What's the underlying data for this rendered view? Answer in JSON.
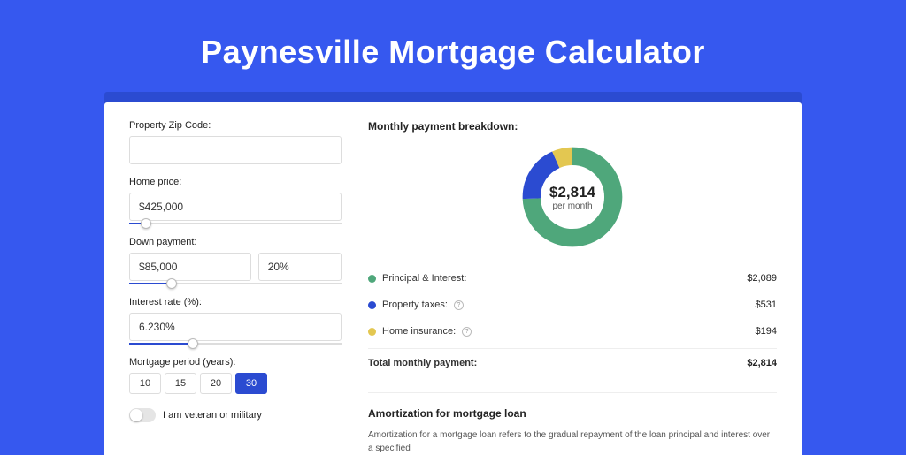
{
  "title": "Paynesville Mortgage Calculator",
  "left": {
    "zip_label": "Property Zip Code:",
    "zip_value": "",
    "home_label": "Home price:",
    "home_value": "$425,000",
    "home_slider_pct": 8,
    "down_label": "Down payment:",
    "down_value": "$85,000",
    "down_pct_value": "20%",
    "down_slider_pct": 20,
    "rate_label": "Interest rate (%):",
    "rate_value": "6.230%",
    "rate_slider_pct": 30,
    "period_label": "Mortgage period (years):",
    "periods": [
      "10",
      "15",
      "20",
      "30"
    ],
    "period_selected": "30",
    "veteran_label": "I am veteran or military"
  },
  "right": {
    "breakdown_title": "Monthly payment breakdown:",
    "center_value": "$2,814",
    "center_sub": "per month",
    "rows": [
      {
        "label": "Principal & Interest:",
        "amount": "$2,089",
        "info": false
      },
      {
        "label": "Property taxes:",
        "amount": "$531",
        "info": true
      },
      {
        "label": "Home insurance:",
        "amount": "$194",
        "info": true
      }
    ],
    "total_label": "Total monthly payment:",
    "total_amount": "$2,814",
    "amort_title": "Amortization for mortgage loan",
    "amort_text": "Amortization for a mortgage loan refers to the gradual repayment of the loan principal and interest over a specified"
  },
  "chart_data": {
    "type": "pie",
    "title": "Monthly payment breakdown",
    "series": [
      {
        "name": "Principal & Interest",
        "value": 2089,
        "color": "#4fa77b"
      },
      {
        "name": "Property taxes",
        "value": 531,
        "color": "#2b4bd1"
      },
      {
        "name": "Home insurance",
        "value": 194,
        "color": "#e3c751"
      }
    ],
    "total": 2814,
    "center_label": "$2,814 per month"
  }
}
